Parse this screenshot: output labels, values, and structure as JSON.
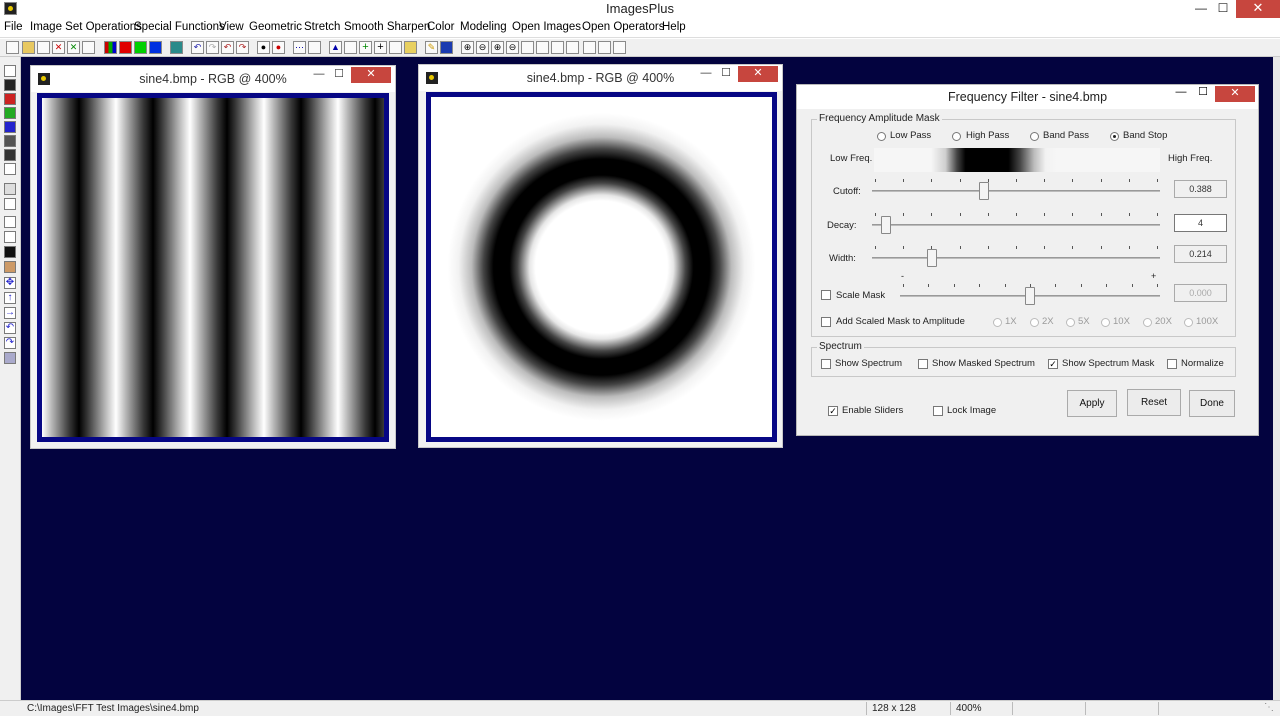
{
  "app": {
    "title": "ImagesPlus"
  },
  "menu": [
    "File",
    "Image Set Operations",
    "Special Functions",
    "View",
    "Geometric",
    "Stretch",
    "Smooth Sharpen",
    "Color",
    "Modeling",
    "Open Images",
    "Open Operators",
    "Help"
  ],
  "windows": [
    {
      "title": "sine4.bmp - RGB @ 400%"
    },
    {
      "title": "sine4.bmp - RGB @ 400%"
    }
  ],
  "dialog": {
    "title": "Frequency Filter - sine4.bmp",
    "amplitude_group": "Frequency Amplitude Mask",
    "filter_types": [
      "Low Pass",
      "High Pass",
      "Band Pass",
      "Band Stop"
    ],
    "filter_selected": "Band Stop",
    "low_freq_label": "Low Freq.",
    "high_freq_label": "High Freq.",
    "cutoff": {
      "label": "Cutoff:",
      "value": "0.388",
      "fraction": 0.39
    },
    "decay": {
      "label": "Decay:",
      "value": "4",
      "fraction": 0.05
    },
    "width": {
      "label": "Width:",
      "value": "0.214",
      "fraction": 0.21
    },
    "scale_mask": {
      "label": "Scale Mask",
      "value": "0.000",
      "fraction": 0.5,
      "checked": false
    },
    "add_scaled": {
      "label": "Add Scaled Mask to Amplitude",
      "checked": false
    },
    "scale_options": [
      "1X",
      "2X",
      "5X",
      "10X",
      "20X",
      "100X"
    ],
    "spectrum_group": "Spectrum",
    "spectrum_options": [
      {
        "label": "Show Spectrum",
        "checked": false
      },
      {
        "label": "Show Masked Spectrum",
        "checked": false
      },
      {
        "label": "Show Spectrum Mask",
        "checked": true
      },
      {
        "label": "Normalize",
        "checked": false
      }
    ],
    "enable_sliders": {
      "label": "Enable Sliders",
      "checked": true
    },
    "lock_image": {
      "label": "Lock Image",
      "checked": false
    },
    "buttons": {
      "apply": "Apply",
      "reset": "Reset",
      "done": "Done"
    }
  },
  "status": {
    "path": "C:\\Images\\FFT Test Images\\sine4.bmp",
    "size": "128 x 128",
    "zoom": "400%"
  },
  "colors": {
    "workspace": "#03033f",
    "frame": "#070784",
    "close": "#c7463e"
  }
}
